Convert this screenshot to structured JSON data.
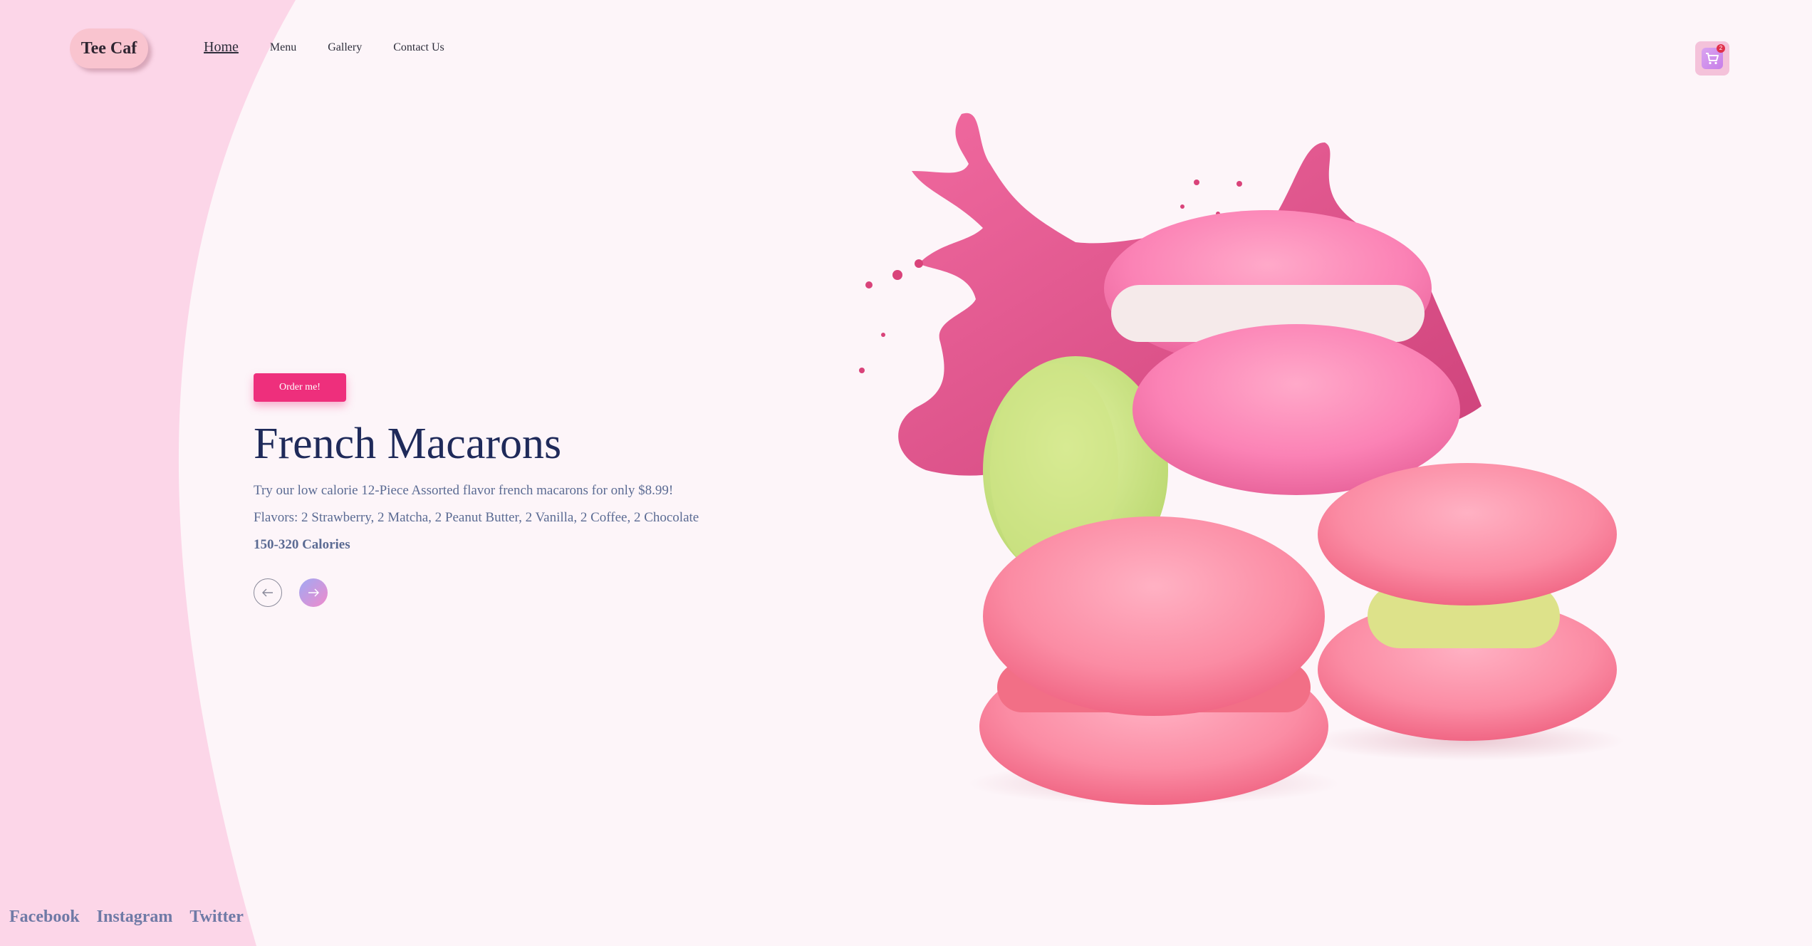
{
  "brand": {
    "logo_text": "Tee Caf"
  },
  "nav": {
    "items": [
      {
        "label": "Home"
      },
      {
        "label": "Menu"
      },
      {
        "label": "Gallery"
      },
      {
        "label": "Contact Us"
      }
    ]
  },
  "cart": {
    "icon": "cart-icon",
    "badge": "2"
  },
  "hero": {
    "button_label": "Order me!",
    "title": "French Macarons",
    "line1": "Try our low calorie 12-Piece Assorted flavor french macarons for only $8.99!",
    "line2": "Flavors: 2 Strawberry, 2 Matcha, 2 Peanut Butter, 2 Vanilla, 2 Coffee, 2 Chocolate",
    "calories": "150-320 Calories",
    "prev_icon": "arrow-left-icon",
    "next_icon": "arrow-right-icon"
  },
  "social": {
    "links": [
      {
        "label": "Facebook"
      },
      {
        "label": "Instagram"
      },
      {
        "label": "Twitter"
      }
    ]
  },
  "colors": {
    "page_bg": "#fdf5f9",
    "side_panel": "#fcd6e8",
    "accent": "#ee2f7c",
    "title": "#1f2a5a",
    "body_text": "#5b6b93"
  }
}
